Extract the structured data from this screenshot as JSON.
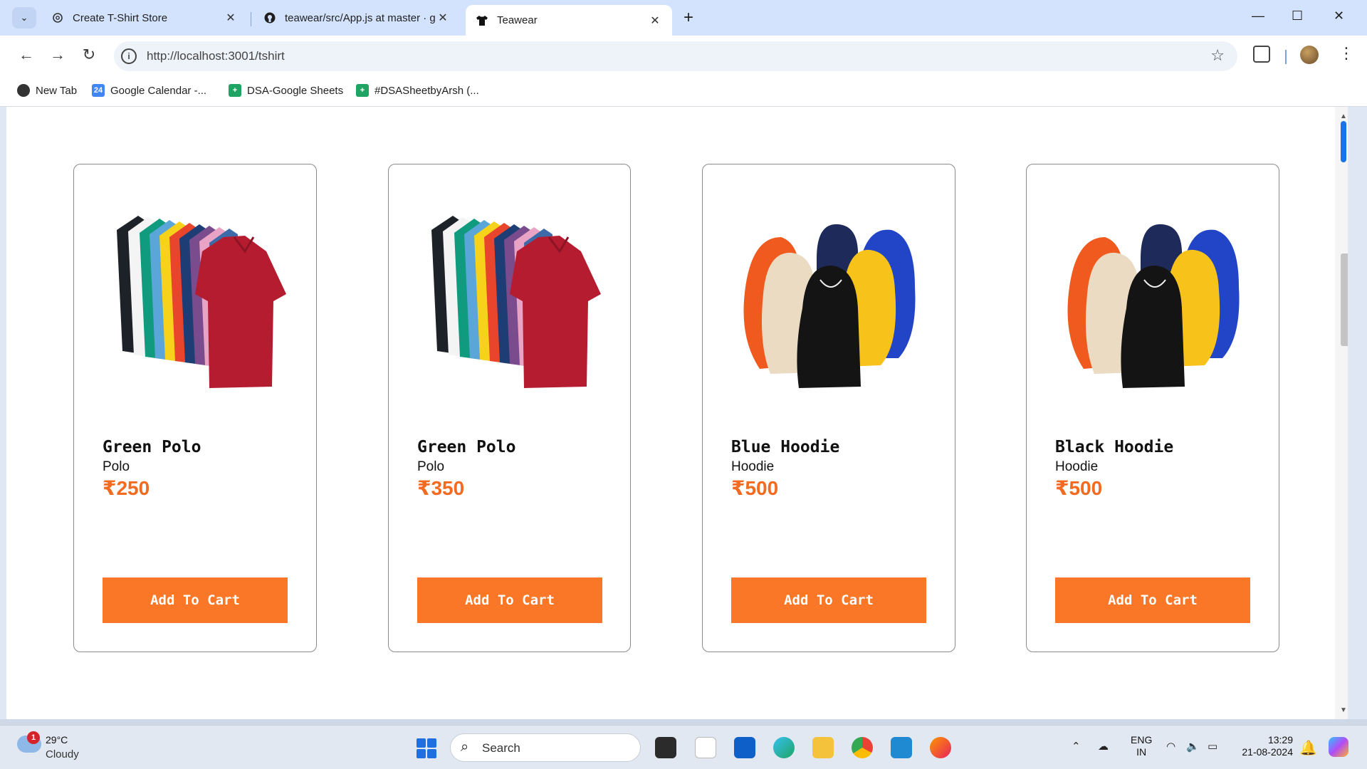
{
  "browser": {
    "tabs": [
      {
        "title": "Create T-Shirt Store",
        "icon": "openai-icon",
        "active": false
      },
      {
        "title": "teawear/src/App.js at master · g",
        "icon": "github-icon",
        "active": false
      },
      {
        "title": "Teawear",
        "icon": "tshirt-icon",
        "active": true
      }
    ],
    "url": "http://localhost:3001/tshirt",
    "bookmarks": [
      {
        "label": "New Tab",
        "icon": "globe-icon"
      },
      {
        "label": "Google Calendar -...",
        "icon": "calendar-icon",
        "badge": "24"
      },
      {
        "label": "DSA-Google Sheets",
        "icon": "sheets-icon"
      },
      {
        "label": "#DSASheetbyArsh (...",
        "icon": "sheets-icon"
      }
    ]
  },
  "products": [
    {
      "name": "Green Polo",
      "category": "Polo",
      "price": "₹250",
      "button": "Add To Cart",
      "image": "polo-shirts"
    },
    {
      "name": "Green Polo",
      "category": "Polo",
      "price": "₹350",
      "button": "Add To Cart",
      "image": "polo-shirts"
    },
    {
      "name": "Blue Hoodie",
      "category": "Hoodie",
      "price": "₹500",
      "button": "Add To Cart",
      "image": "hoodies"
    },
    {
      "name": "Black Hoodie",
      "category": "Hoodie",
      "price": "₹500",
      "button": "Add To Cart",
      "image": "hoodies"
    }
  ],
  "colors": {
    "accent": "#f97726",
    "price": "#f26b21",
    "chrome_tabstrip": "#d3e3fd"
  },
  "taskbar": {
    "weather_temp": "29°C",
    "weather_desc": "Cloudy",
    "weather_badge": "1",
    "search_label": "Search",
    "lang_line1": "ENG",
    "lang_line2": "IN",
    "time": "13:29",
    "date": "21-08-2024"
  }
}
